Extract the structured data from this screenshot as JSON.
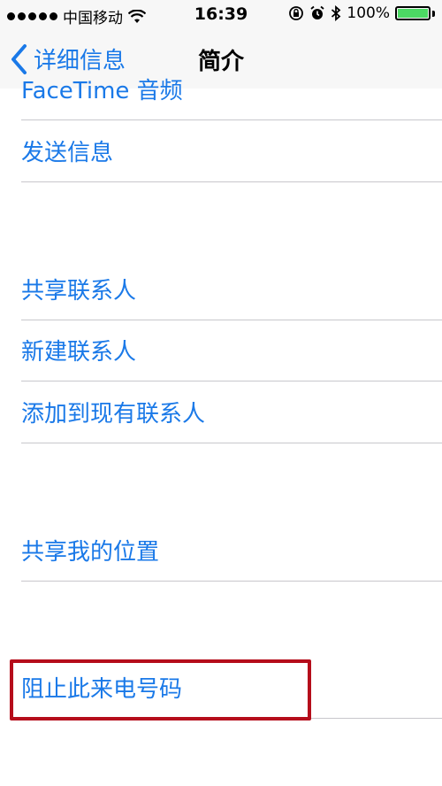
{
  "status_bar": {
    "carrier": "中国移动",
    "time": "16:39",
    "battery": "100%",
    "battery_level": 1.0
  },
  "nav": {
    "back_label": "详细信息",
    "title": "简介"
  },
  "rows": {
    "facetime_audio": "FaceTime 音频",
    "send_message": "发送信息",
    "share_contact": "共享联系人",
    "new_contact": "新建联系人",
    "add_to_existing": "添加到现有联系人",
    "share_location": "共享我的位置",
    "block_caller": "阻止此来电号码"
  },
  "colors": {
    "link": "#1a79e8",
    "highlight": "#b50d1b",
    "battery": "#4cd964"
  },
  "icons": [
    "wifi-icon",
    "orientation-lock-icon",
    "alarm-icon",
    "bluetooth-icon",
    "battery-icon",
    "chevron-left-icon"
  ]
}
